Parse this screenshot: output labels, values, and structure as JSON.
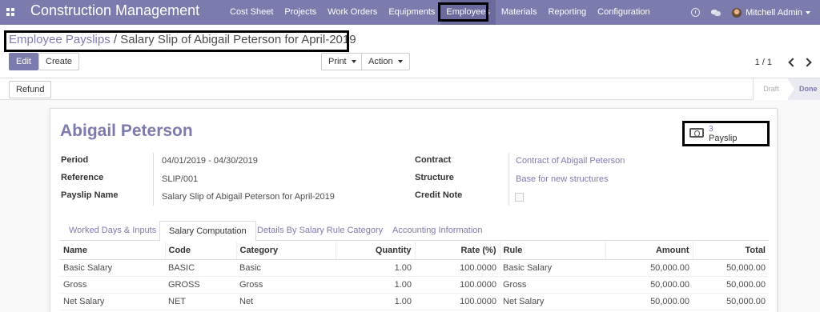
{
  "navbar": {
    "app_title": "Construction Management",
    "menu": [
      "Cost Sheet",
      "Projects",
      "Work Orders",
      "Equipments",
      "Employees",
      "Materials",
      "Reporting",
      "Configuration"
    ],
    "active_menu": "Employees",
    "user": "Mitchell Admin",
    "icons": [
      "apps-icon",
      "clock-icon",
      "chat-icon"
    ],
    "accent_color": "#7c7bad"
  },
  "control_panel": {
    "breadcrumb_parent": "Employee Payslips",
    "breadcrumb_separator": "/",
    "breadcrumb_current": "Salary Slip of Abigail Peterson for April-2019",
    "edit_label": "Edit",
    "create_label": "Create",
    "print_label": "Print",
    "action_label": "Action",
    "pager": "1 / 1"
  },
  "status_bar": {
    "refund_label": "Refund",
    "stages": [
      "Draft",
      "Done"
    ],
    "current_stage": "Done"
  },
  "form": {
    "employee_name": "Abigail Peterson",
    "smart_button": {
      "count": "3",
      "label": "Payslip"
    },
    "left_fields": [
      {
        "label": "Period",
        "value": "04/01/2019 - 04/30/2019"
      },
      {
        "label": "Reference",
        "value": "SLIP/001"
      },
      {
        "label": "Payslip Name",
        "value": "Salary Slip of Abigail Peterson for April-2019"
      }
    ],
    "right_fields": [
      {
        "label": "Contract",
        "value": "Contract of Abigail Peterson"
      },
      {
        "label": "Structure",
        "value": "Base for new structures"
      },
      {
        "label": "Credit Note",
        "value": ""
      }
    ],
    "credit_note_checked": false
  },
  "tabs": [
    "Worked Days & Inputs",
    "Salary Computation",
    "Details By Salary Rule Category",
    "Accounting Information"
  ],
  "active_tab": "Salary Computation",
  "table": {
    "headers": [
      "Name",
      "Code",
      "Category",
      "Quantity",
      "Rate (%)",
      "Rule",
      "Amount",
      "Total"
    ],
    "rows": [
      [
        "Basic Salary",
        "BASIC",
        "Basic",
        "1.00",
        "100.0000",
        "Basic Salary",
        "50,000.00",
        "50,000.00"
      ],
      [
        "Gross",
        "GROSS",
        "Gross",
        "1.00",
        "100.0000",
        "Gross",
        "50,000.00",
        "50,000.00"
      ],
      [
        "Net Salary",
        "NET",
        "Net",
        "1.00",
        "100.0000",
        "Net Salary",
        "50,000.00",
        "50,000.00"
      ]
    ]
  }
}
